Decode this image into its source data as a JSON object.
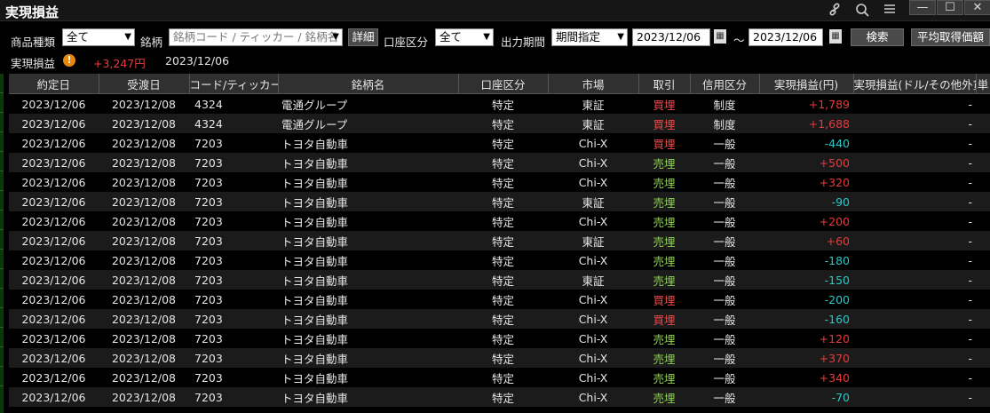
{
  "window": {
    "title": "実現損益"
  },
  "colors": {
    "positive": "#e83a3a",
    "negative": "#2bc8c8",
    "buy": "#f04a4a",
    "sell": "#8fd14f"
  },
  "filters": {
    "product_type_label": "商品種類",
    "product_type_value": "全て",
    "symbol_label": "銘柄",
    "symbol_placeholder": "銘柄コード / ティッカー / 銘柄名",
    "detail_button": "詳細",
    "account_label": "口座区分",
    "account_value": "全て",
    "period_label": "出力期間",
    "period_value": "期間指定",
    "date_from": "2023/12/06",
    "tilde": "～",
    "date_to": "2023/12/06",
    "search_button": "検索",
    "avg_price_button": "平均取得価額"
  },
  "summary": {
    "label": "実現損益",
    "warn_glyph": "!",
    "total": "+3,247円",
    "date": "2023/12/06"
  },
  "table": {
    "headers": [
      "約定日",
      "受渡日",
      "コード/ティッカー",
      "銘柄名",
      "口座区分",
      "市場",
      "取引",
      "信用区分",
      "実現損益(円)",
      "実現損益(ドル/その他外貨)",
      "単"
    ],
    "rows": [
      {
        "trade_date": "2023/12/06",
        "settle_date": "2023/12/08",
        "code": "4324",
        "name": "電通グループ",
        "account": "特定",
        "market": "東証",
        "side": "買埋",
        "side_type": "buy",
        "margin": "制度",
        "pnl": "+1,789",
        "pnl_type": "pos",
        "pnl_fx": "-"
      },
      {
        "trade_date": "2023/12/06",
        "settle_date": "2023/12/08",
        "code": "4324",
        "name": "電通グループ",
        "account": "特定",
        "market": "東証",
        "side": "買埋",
        "side_type": "buy",
        "margin": "制度",
        "pnl": "+1,688",
        "pnl_type": "pos",
        "pnl_fx": "-"
      },
      {
        "trade_date": "2023/12/06",
        "settle_date": "2023/12/08",
        "code": "7203",
        "name": "トヨタ自動車",
        "account": "特定",
        "market": "Chi-X",
        "side": "買埋",
        "side_type": "buy",
        "margin": "一般",
        "pnl": "-440",
        "pnl_type": "neg",
        "pnl_fx": "-"
      },
      {
        "trade_date": "2023/12/06",
        "settle_date": "2023/12/08",
        "code": "7203",
        "name": "トヨタ自動車",
        "account": "特定",
        "market": "Chi-X",
        "side": "売埋",
        "side_type": "sell",
        "margin": "一般",
        "pnl": "+500",
        "pnl_type": "pos",
        "pnl_fx": "-"
      },
      {
        "trade_date": "2023/12/06",
        "settle_date": "2023/12/08",
        "code": "7203",
        "name": "トヨタ自動車",
        "account": "特定",
        "market": "Chi-X",
        "side": "売埋",
        "side_type": "sell",
        "margin": "一般",
        "pnl": "+320",
        "pnl_type": "pos",
        "pnl_fx": "-"
      },
      {
        "trade_date": "2023/12/06",
        "settle_date": "2023/12/08",
        "code": "7203",
        "name": "トヨタ自動車",
        "account": "特定",
        "market": "東証",
        "side": "売埋",
        "side_type": "sell",
        "margin": "一般",
        "pnl": "-90",
        "pnl_type": "neg",
        "pnl_fx": "-"
      },
      {
        "trade_date": "2023/12/06",
        "settle_date": "2023/12/08",
        "code": "7203",
        "name": "トヨタ自動車",
        "account": "特定",
        "market": "Chi-X",
        "side": "売埋",
        "side_type": "sell",
        "margin": "一般",
        "pnl": "+200",
        "pnl_type": "pos",
        "pnl_fx": "-"
      },
      {
        "trade_date": "2023/12/06",
        "settle_date": "2023/12/08",
        "code": "7203",
        "name": "トヨタ自動車",
        "account": "特定",
        "market": "東証",
        "side": "売埋",
        "side_type": "sell",
        "margin": "一般",
        "pnl": "+60",
        "pnl_type": "pos",
        "pnl_fx": "-"
      },
      {
        "trade_date": "2023/12/06",
        "settle_date": "2023/12/08",
        "code": "7203",
        "name": "トヨタ自動車",
        "account": "特定",
        "market": "Chi-X",
        "side": "売埋",
        "side_type": "sell",
        "margin": "一般",
        "pnl": "-180",
        "pnl_type": "neg",
        "pnl_fx": "-"
      },
      {
        "trade_date": "2023/12/06",
        "settle_date": "2023/12/08",
        "code": "7203",
        "name": "トヨタ自動車",
        "account": "特定",
        "market": "東証",
        "side": "売埋",
        "side_type": "sell",
        "margin": "一般",
        "pnl": "-150",
        "pnl_type": "neg",
        "pnl_fx": "-"
      },
      {
        "trade_date": "2023/12/06",
        "settle_date": "2023/12/08",
        "code": "7203",
        "name": "トヨタ自動車",
        "account": "特定",
        "market": "Chi-X",
        "side": "買埋",
        "side_type": "buy",
        "margin": "一般",
        "pnl": "-200",
        "pnl_type": "neg",
        "pnl_fx": "-"
      },
      {
        "trade_date": "2023/12/06",
        "settle_date": "2023/12/08",
        "code": "7203",
        "name": "トヨタ自動車",
        "account": "特定",
        "market": "Chi-X",
        "side": "買埋",
        "side_type": "buy",
        "margin": "一般",
        "pnl": "-160",
        "pnl_type": "neg",
        "pnl_fx": "-"
      },
      {
        "trade_date": "2023/12/06",
        "settle_date": "2023/12/08",
        "code": "7203",
        "name": "トヨタ自動車",
        "account": "特定",
        "market": "Chi-X",
        "side": "売埋",
        "side_type": "sell",
        "margin": "一般",
        "pnl": "+120",
        "pnl_type": "pos",
        "pnl_fx": "-"
      },
      {
        "trade_date": "2023/12/06",
        "settle_date": "2023/12/08",
        "code": "7203",
        "name": "トヨタ自動車",
        "account": "特定",
        "market": "Chi-X",
        "side": "売埋",
        "side_type": "sell",
        "margin": "一般",
        "pnl": "+370",
        "pnl_type": "pos",
        "pnl_fx": "-"
      },
      {
        "trade_date": "2023/12/06",
        "settle_date": "2023/12/08",
        "code": "7203",
        "name": "トヨタ自動車",
        "account": "特定",
        "market": "Chi-X",
        "side": "売埋",
        "side_type": "sell",
        "margin": "一般",
        "pnl": "+340",
        "pnl_type": "pos",
        "pnl_fx": "-"
      },
      {
        "trade_date": "2023/12/06",
        "settle_date": "2023/12/08",
        "code": "7203",
        "name": "トヨタ自動車",
        "account": "特定",
        "market": "Chi-X",
        "side": "売埋",
        "side_type": "sell",
        "margin": "一般",
        "pnl": "-70",
        "pnl_type": "neg",
        "pnl_fx": "-"
      }
    ]
  },
  "icons": {
    "link": "link-icon",
    "search": "search-icon",
    "menu": "menu-icon",
    "minimize": "minimize-icon",
    "maximize": "maximize-icon",
    "close": "close-icon",
    "calendar": "calendar-icon"
  }
}
